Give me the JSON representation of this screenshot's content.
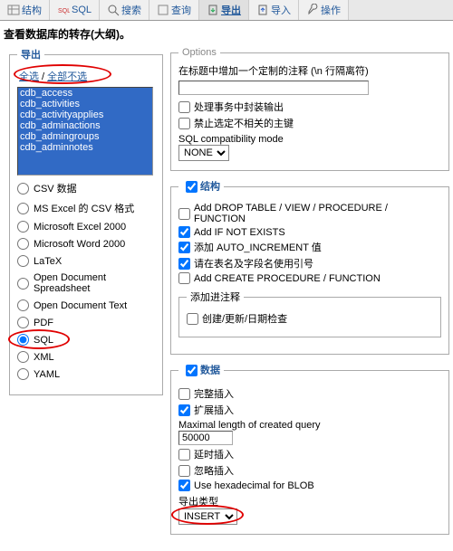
{
  "tabs": {
    "structure": "结构",
    "sql": "SQL",
    "search": "搜索",
    "query": "查询",
    "export": "导出",
    "import": "导入",
    "operations": "操作"
  },
  "page_title": "查看数据库的转存(大纲)。",
  "export": {
    "legend": "导出",
    "select_all": "全选",
    "deselect_all": "全部不选",
    "tables": [
      "cdb_access",
      "cdb_activities",
      "cdb_activityapplies",
      "cdb_adminactions",
      "cdb_admingroups",
      "cdb_adminnotes"
    ],
    "formats": {
      "csv": "CSV 数据",
      "ms_excel_csv": "MS Excel 的 CSV 格式",
      "ms_excel_2000": "Microsoft Excel 2000",
      "ms_word_2000": "Microsoft Word 2000",
      "latex": "LaTeX",
      "od_spreadsheet": "Open Document Spreadsheet",
      "od_text": "Open Document Text",
      "pdf": "PDF",
      "sql": "SQL",
      "xml": "XML",
      "yaml": "YAML"
    }
  },
  "options": {
    "legend": "Options",
    "comment_label": "在标题中增加一个定制的注释 (\\n 行隔离符)",
    "encapsulate": "处理事务中封装输出",
    "disable_fk": "禁止选定不相关的主键",
    "compat_label": "SQL compatibility mode",
    "compat_value": "NONE"
  },
  "structure": {
    "legend": "结构",
    "add_drop": "Add DROP TABLE / VIEW / PROCEDURE / FUNCTION",
    "if_not_exists": "Add IF NOT EXISTS",
    "auto_increment": "添加 AUTO_INCREMENT 值",
    "backquotes": "请在表名及字段名使用引号",
    "add_create_proc": "Add CREATE PROCEDURE / FUNCTION",
    "add_into_comments_legend": "添加进注释",
    "creation_dates": "创建/更新/日期检查"
  },
  "data": {
    "legend": "数据",
    "complete_insert": "完整插入",
    "extended_insert": "扩展插入",
    "max_query_label": "Maximal length of created query",
    "max_query_value": "50000",
    "delayed_insert": "延时插入",
    "ignore_insert": "忽略插入",
    "hex_blob": "Use hexadecimal for BLOB",
    "export_type_label": "导出类型",
    "export_type_value": "INSERT"
  }
}
